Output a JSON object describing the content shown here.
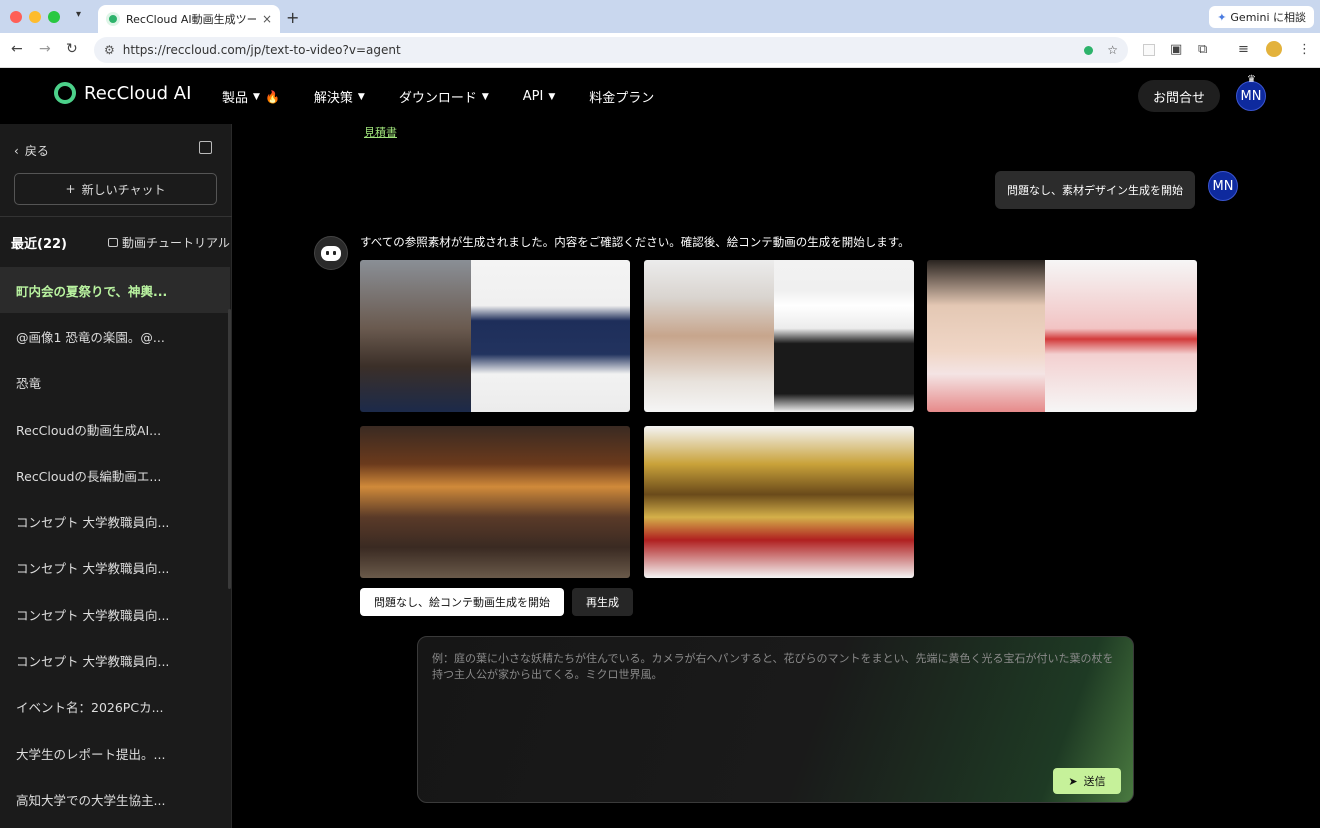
{
  "browser": {
    "tab_title": "RecCloud AI動画生成ツール - ",
    "url": "https://reccloud.com/jp/text-to-video?v=agent",
    "gemini_label": "Gemini に相談"
  },
  "header": {
    "logo_text": "RecCloud AI",
    "menu": [
      {
        "label": "製品"
      },
      {
        "label": "解決策"
      },
      {
        "label": "ダウンロード"
      },
      {
        "label": "API"
      },
      {
        "label": "料金プラン"
      }
    ],
    "contact_label": "お問合せ",
    "avatar_initials": "MN"
  },
  "sidebar": {
    "back_label": "戻る",
    "new_chat_label": "新しいチャット",
    "recent_label": "最近(22)",
    "tutorial_label": "動画チュートリアル",
    "history": [
      "町内会の夏祭りで、神輿...",
      "@画像1 恐竜の楽園。@...",
      "恐竜",
      "RecCloudの動画生成AI...",
      "RecCloudの長編動画エ...",
      "コンセプト 大学教職員向...",
      "コンセプト 大学教職員向...",
      "コンセプト 大学教職員向...",
      "コンセプト 大学教職員向...",
      "イベント名：2026PCカ...",
      "大学生のレポート提出。...",
      "高知大学での大学生協主..."
    ]
  },
  "chat": {
    "estimate_link": "見積書",
    "user_message": "問題なし、素材デザイン生成を開始",
    "user_initials": "MN",
    "bot_message": "すべての参照素材が生成されました。内容をご確認ください。確認後、絵コンテ動画の生成を開始します。",
    "approve_label": "問題なし、絵コンテ動画生成を開始",
    "regenerate_label": "再生成"
  },
  "composer": {
    "placeholder": "例：庭の葉に小さな妖精たちが住んでいる。カメラが右へパンすると、花びらのマントをまとい、先端に黄色く光る宝石が付いた葉の杖を持つ主人公が家から出てくる。ミクロ世界風。",
    "send_label": "送信"
  }
}
